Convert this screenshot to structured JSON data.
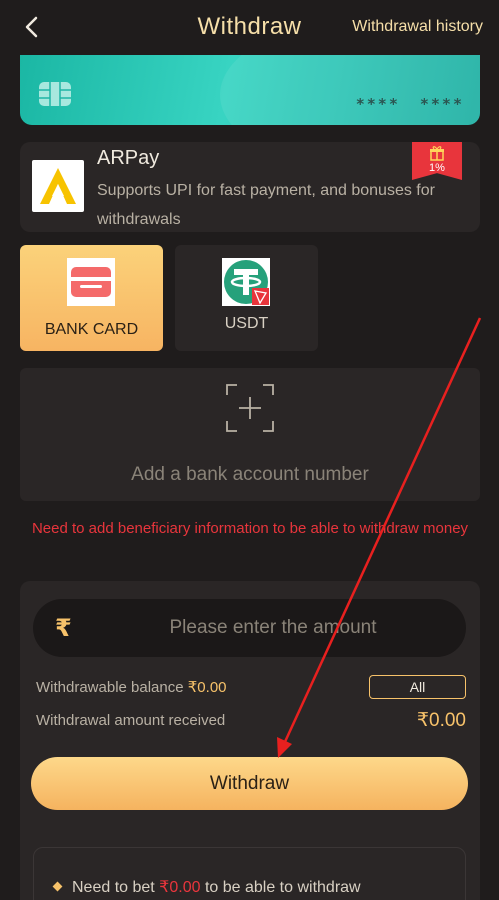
{
  "header": {
    "title": "Withdraw",
    "history_link": "Withdrawal history"
  },
  "card": {
    "number_part1": "****",
    "number_part2": "****"
  },
  "arpay": {
    "name": "ARPay",
    "description": "Supports UPI for fast payment, and bonuses for withdrawals",
    "badge": "1%"
  },
  "methods": [
    {
      "label": "BANK CARD",
      "selected": true
    },
    {
      "label": "USDT",
      "selected": false
    }
  ],
  "add_bank": {
    "label": "Add a bank account number"
  },
  "warning": "Need to add beneficiary information to be able to withdraw money",
  "amount": {
    "currency_symbol": "₹",
    "placeholder": "Please enter the amount",
    "value": ""
  },
  "balance": {
    "label": "Withdrawable balance ",
    "value": "₹0.00",
    "all_label": "All"
  },
  "received": {
    "label": "Withdrawal amount received",
    "value": "₹0.00"
  },
  "withdraw_button": "Withdraw",
  "note": {
    "prefix": "Need to bet ",
    "amount": "₹0.00",
    "suffix": " to be able to withdraw"
  },
  "colors": {
    "accent": "#f7c26a",
    "warning": "#e8353c",
    "annotation_arrow": "#e8201f"
  }
}
